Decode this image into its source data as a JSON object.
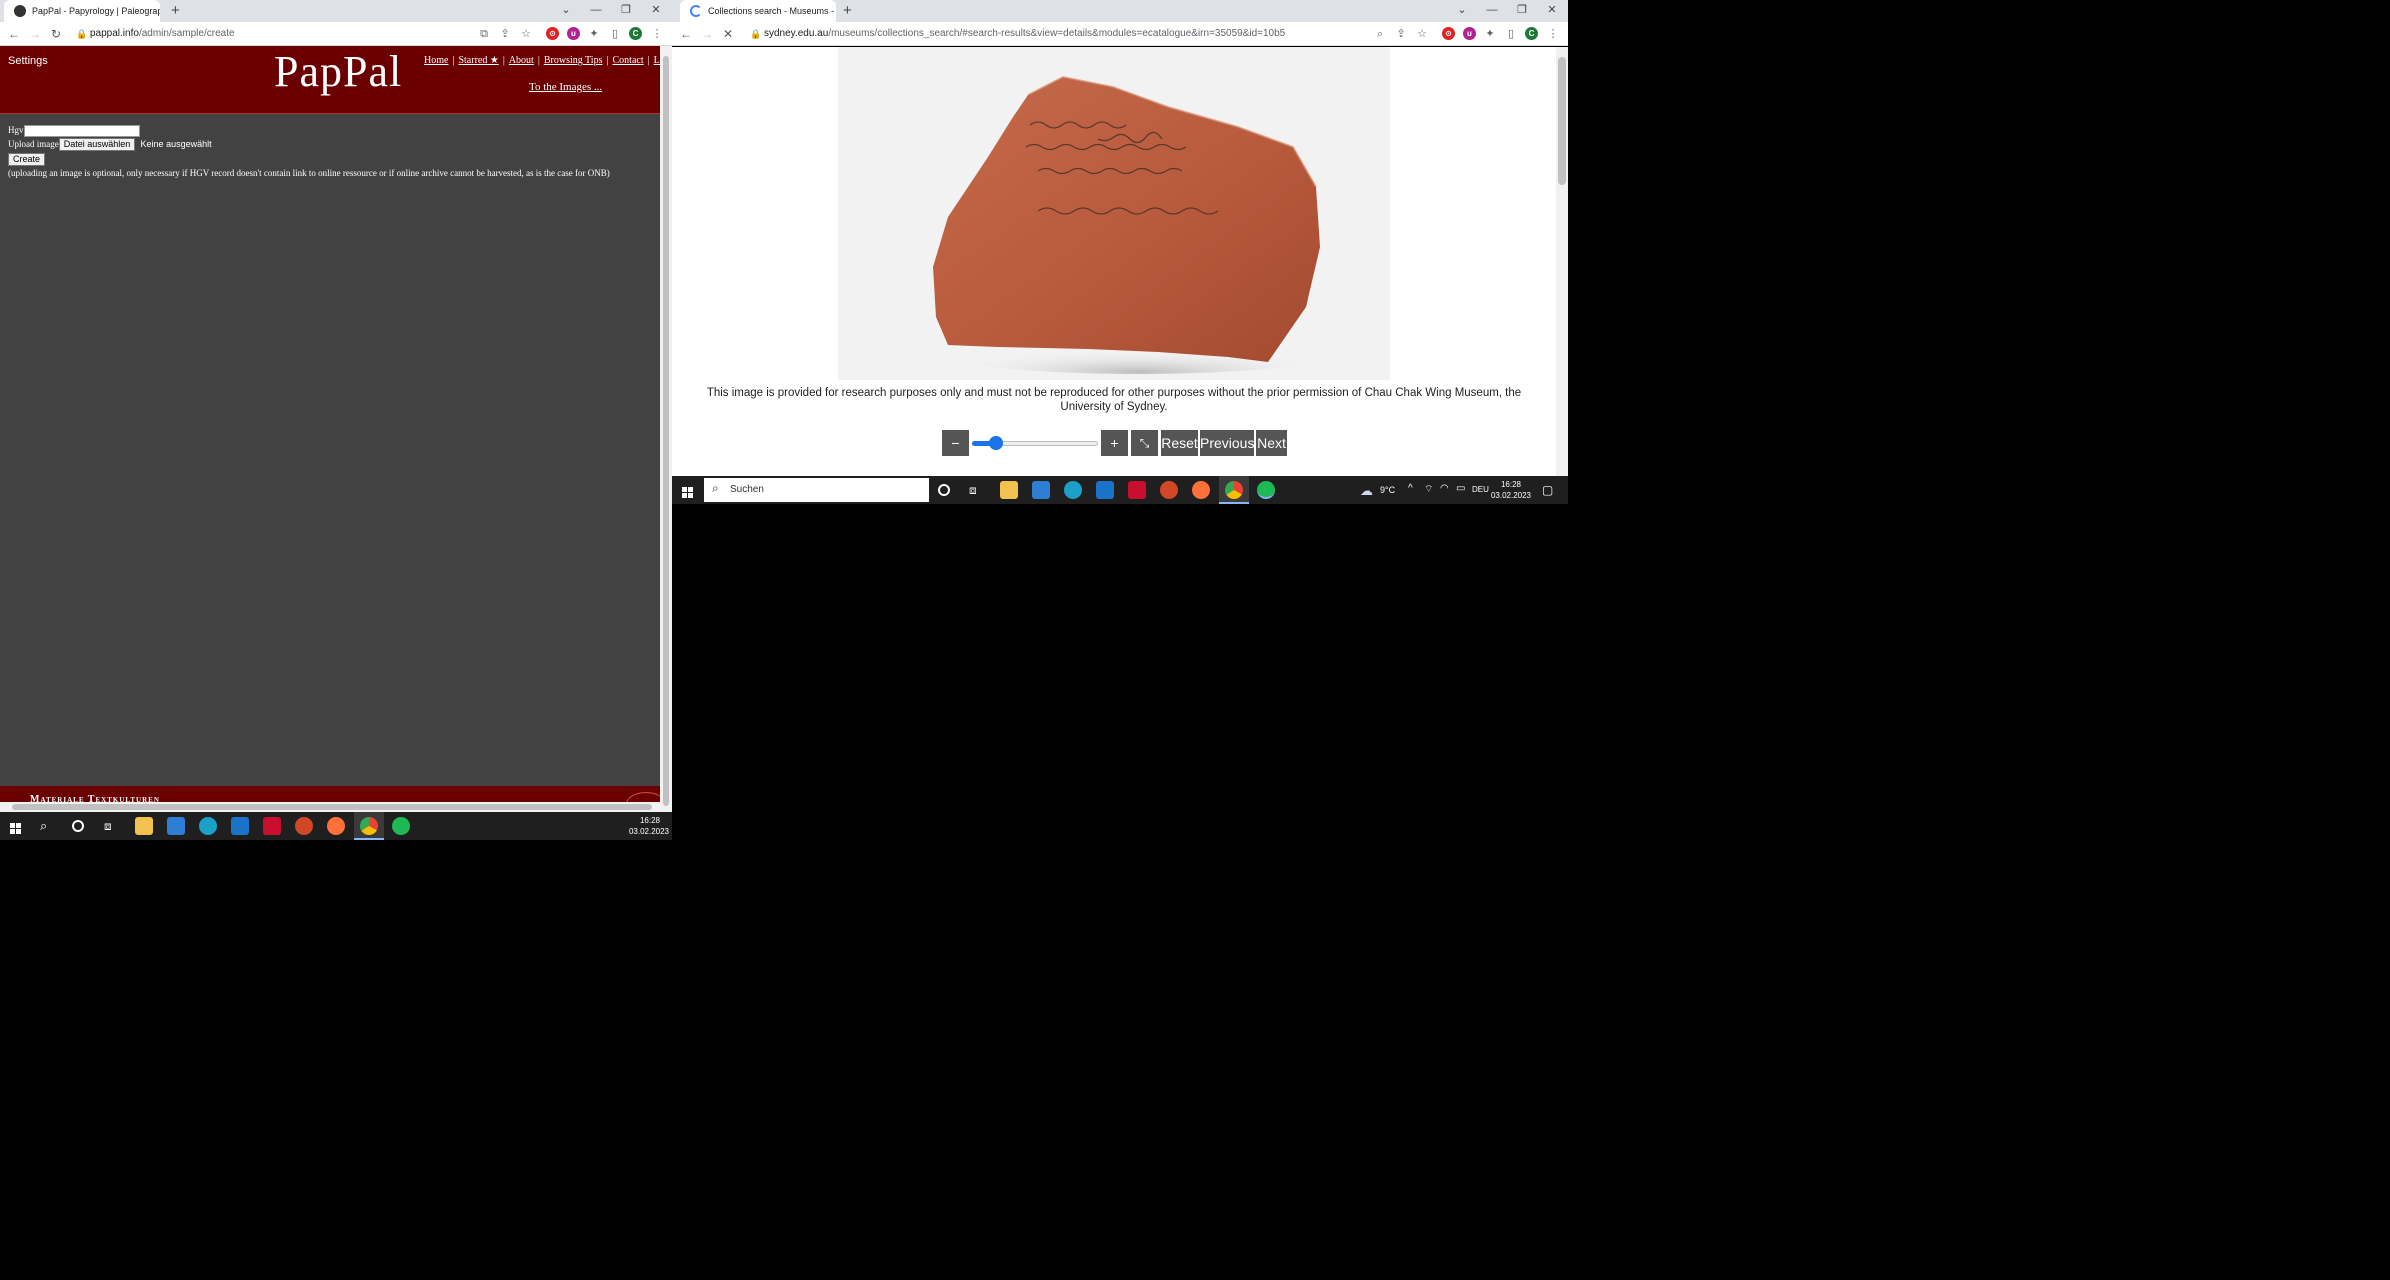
{
  "left_browser": {
    "tab_title": "PapPal - Papyrology | Paleograph",
    "url_host": "pappal.info",
    "url_path": "/admin/sample/create",
    "profile_initial": "C"
  },
  "pappal": {
    "settings": "Settings",
    "logo": "PapPal",
    "nav": [
      "Home",
      "Starred ★",
      "About",
      "Browsing Tips",
      "Contact",
      "Logou"
    ],
    "to_images": "To the Images ...",
    "hgv_label": "Hgv",
    "upload_label": "Upload image",
    "file_button": "Datei auswählen",
    "file_status": "Keine ausgewählt",
    "create_button": "Create",
    "note": "(uploading an image is optional, only necessary if HGV record doesn't contain link to online ressource or if online archive cannot be harvested, as is the case for ONB)",
    "footer_text": "Materiale Textkulturen"
  },
  "right_browser": {
    "tab_title": "Collections search - Museums - T",
    "url_host": "sydney.edu.au",
    "url_path": "/museums/collections_search/#search-results&view=details&modules=ecatalogue&irn=35059&id=10b5",
    "profile_initial": "C"
  },
  "viewer": {
    "notice": "This image is provided for research purposes only and must not be reproduced for other purposes without the prior permission of Chau Chak Wing Museum, the University of Sydney.",
    "zoom_out": "−",
    "zoom_in": "+",
    "fullscreen": "⤡",
    "reset": "Reset",
    "previous": "Previous",
    "next": "Next",
    "zoom_level": 0.15
  },
  "taskbar_right": {
    "search_placeholder": "Suchen",
    "weather": "9°C",
    "lang": "DEU",
    "time": "16:28",
    "date": "03.02.2023"
  },
  "taskbar_left": {
    "time": "16:28",
    "date": "03.02.2023"
  },
  "colors": {
    "pappal_header": "#6b0001",
    "pappal_body": "#424242",
    "taskbar": "#1f1f1f"
  }
}
